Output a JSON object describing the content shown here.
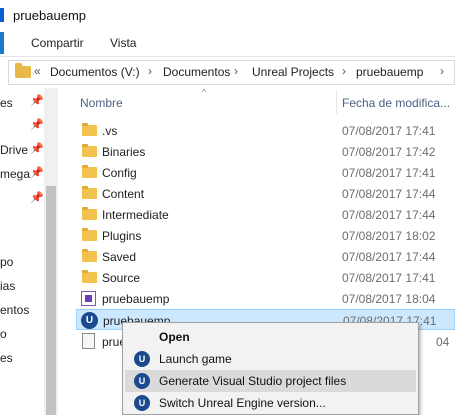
{
  "window": {
    "title": "pruebauemp"
  },
  "ribbon": {
    "tabs": [
      "Compartir",
      "Vista"
    ]
  },
  "address": {
    "overflow": "«",
    "crumbs": [
      "Documentos (V:)",
      "Documentos",
      "Unreal Projects",
      "pruebauemp"
    ],
    "separator": "›"
  },
  "nav": {
    "items": [
      "es",
      "Drive",
      "mega",
      "po",
      "ias",
      "entos",
      "o",
      "es"
    ],
    "pin_glyph": "📌"
  },
  "columns": {
    "name": "Nombre",
    "date": "Fecha de modifica..."
  },
  "files": [
    {
      "name": ".vs",
      "date": "07/08/2017 17:41",
      "icon": "folder-icon"
    },
    {
      "name": "Binaries",
      "date": "07/08/2017 17:42",
      "icon": "folder-icon"
    },
    {
      "name": "Config",
      "date": "07/08/2017 17:41",
      "icon": "folder-icon"
    },
    {
      "name": "Content",
      "date": "07/08/2017 17:44",
      "icon": "folder-icon"
    },
    {
      "name": "Intermediate",
      "date": "07/08/2017 17:44",
      "icon": "folder-icon"
    },
    {
      "name": "Plugins",
      "date": "07/08/2017 18:02",
      "icon": "folder-icon"
    },
    {
      "name": "Saved",
      "date": "07/08/2017 17:44",
      "icon": "folder-icon"
    },
    {
      "name": "Source",
      "date": "07/08/2017 17:41",
      "icon": "folder-icon"
    },
    {
      "name": "pruebauemp",
      "date": "07/08/2017 18:04",
      "icon": "visual-studio-solution-icon"
    },
    {
      "name": "pruebauemp",
      "date": "07/08/2017 17:41",
      "icon": "unreal-project-icon",
      "selected": true
    },
    {
      "name": "prue",
      "date": "04",
      "icon": "document-icon"
    }
  ],
  "context_menu": {
    "items": [
      {
        "label": "Open",
        "bold": true,
        "icon": ""
      },
      {
        "label": "Launch game",
        "icon": "unreal-engine-icon"
      },
      {
        "label": "Generate Visual Studio project files",
        "icon": "unreal-engine-icon",
        "hover": true
      },
      {
        "label": "Switch Unreal Engine version...",
        "icon": "unreal-engine-icon"
      }
    ]
  },
  "colors": {
    "selection": "#cce8ff",
    "selection_border": "#99d1ff",
    "header_text": "#4d6185",
    "folder": "#f1c24d",
    "menu_bg": "#f2f2f2",
    "menu_hover": "#dadada",
    "unreal_icon": "#1c4a8e"
  }
}
